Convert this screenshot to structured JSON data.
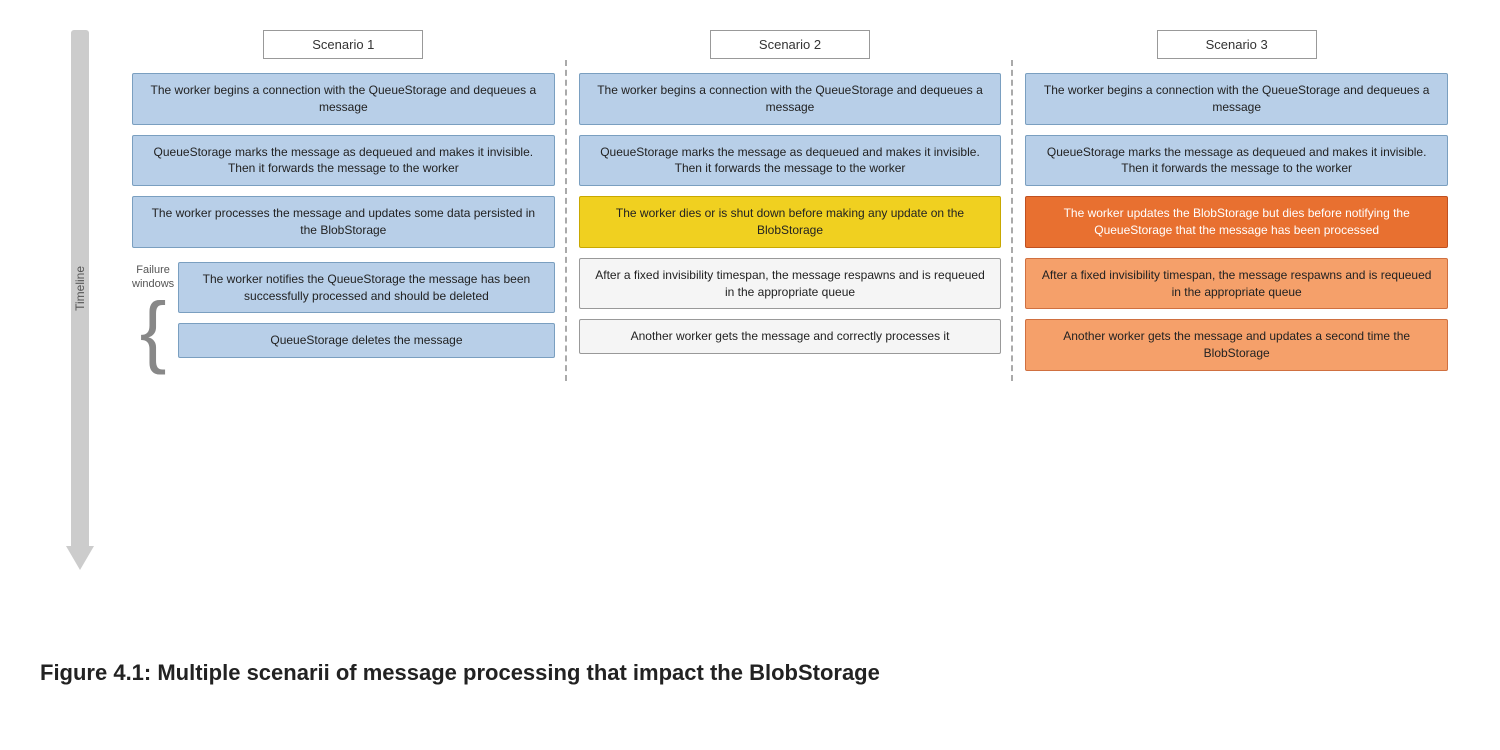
{
  "diagram": {
    "timeline_label": "Timeline",
    "failure_windows_label": "Failure\nwindows",
    "scenarios": [
      {
        "id": "scenario1",
        "title": "Scenario 1",
        "steps": [
          {
            "text": "The worker begins a connection with the QueueStorage and dequeues a message",
            "style": "blue-light"
          },
          {
            "text": "QueueStorage marks the message as dequeued and makes it invisible. Then it forwards the message to the worker",
            "style": "blue-light"
          },
          {
            "text": "The worker processes the message and updates some data persisted in the BlobStorage",
            "style": "blue-light"
          }
        ],
        "lower_steps": [
          {
            "text": "The worker notifies the QueueStorage the message has been successfully processed and should be deleted",
            "style": "blue-light"
          },
          {
            "text": "QueueStorage deletes the message",
            "style": "blue-light"
          }
        ],
        "has_bracket": true
      },
      {
        "id": "scenario2",
        "title": "Scenario 2",
        "steps": [
          {
            "text": "The worker begins a connection with the QueueStorage and dequeues a message",
            "style": "blue-light"
          },
          {
            "text": "QueueStorage marks the message as dequeued and makes it invisible. Then it forwards the message to the worker",
            "style": "blue-light"
          },
          {
            "text": "The worker dies or is shut down before making any update on the BlobStorage",
            "style": "yellow"
          },
          {
            "text": "After a fixed invisibility timespan, the message respawns and is requeued in the appropriate queue",
            "style": "white"
          },
          {
            "text": "Another worker gets the message and correctly processes it",
            "style": "white"
          }
        ],
        "has_bracket": false
      },
      {
        "id": "scenario3",
        "title": "Scenario 3",
        "steps": [
          {
            "text": "The worker begins a connection with the QueueStorage and dequeues a message",
            "style": "blue-light"
          },
          {
            "text": "QueueStorage marks the message as dequeued and makes it invisible. Then it forwards the message to the worker",
            "style": "blue-light"
          },
          {
            "text": "The worker updates the BlobStorage but dies before notifying the QueueStorage that the message has been processed",
            "style": "orange-medium"
          },
          {
            "text": "After a fixed invisibility timespan, the message respawns and is requeued in the appropriate queue",
            "style": "orange-light"
          },
          {
            "text": "Another worker gets the message and updates a second time the BlobStorage",
            "style": "orange-light"
          }
        ],
        "has_bracket": false
      }
    ]
  },
  "figure_caption": "Figure 4.1: Multiple scenarii of message processing that impact the BlobStorage"
}
